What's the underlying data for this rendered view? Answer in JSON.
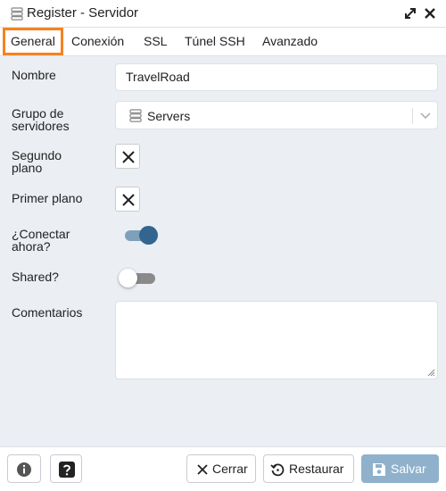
{
  "window": {
    "title": "Register - Servidor"
  },
  "tabs": [
    {
      "label": "General",
      "active": true
    },
    {
      "label": "Conexión",
      "active": false
    },
    {
      "label": "SSL",
      "active": false
    },
    {
      "label": "Túnel SSH",
      "active": false
    },
    {
      "label": "Avanzado",
      "active": false
    }
  ],
  "form": {
    "nombre": {
      "label": "Nombre",
      "value": "TravelRoad"
    },
    "grupo": {
      "label_line1": "Grupo de",
      "label_line2": "servidores",
      "value": "Servers"
    },
    "segundo_plano": {
      "label_line1": "Segundo",
      "label_line2": "plano",
      "checked": false
    },
    "primer_plano": {
      "label": "Primer plano",
      "checked": false
    },
    "conectar_ahora": {
      "label_line1": "¿Conectar",
      "label_line2": "ahora?",
      "on": true
    },
    "shared": {
      "label": "Shared?",
      "on": false
    },
    "comentarios": {
      "label": "Comentarios",
      "value": ""
    }
  },
  "footer": {
    "info_icon": "info-icon",
    "help_icon": "help-icon",
    "cerrar_label": "Cerrar",
    "restaurar_label": "Restaurar",
    "salvar_label": "Salvar"
  },
  "colors": {
    "accent_tab_outline": "#f58220",
    "switch_on_knob": "#326690",
    "switch_on_track": "#7fa0bb",
    "switch_off_track": "#8a8a8a",
    "primary_disabled": "#8fb1cb",
    "content_bg": "#ebeef3"
  }
}
